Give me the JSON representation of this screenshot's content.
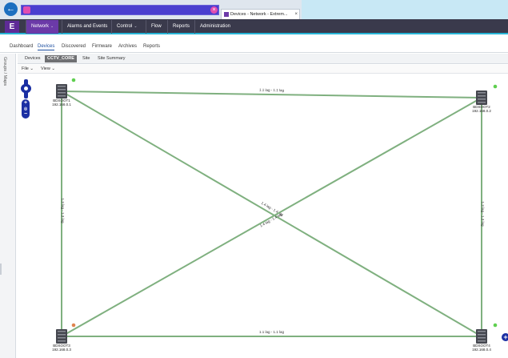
{
  "browser": {
    "tab_title": "Devices - Network - Extrem...",
    "tab_close": "×"
  },
  "appbar": {
    "logo": "E",
    "menu": [
      {
        "label": "Network",
        "active": true
      },
      {
        "label": "Alarms and Events",
        "active": false
      },
      {
        "label": "Control",
        "active": false
      },
      {
        "label": "Flow",
        "active": false
      },
      {
        "label": "Reports",
        "active": false
      },
      {
        "label": "Administration",
        "active": false
      }
    ],
    "caret": "⌄"
  },
  "subnav": [
    "Dashboard",
    "Devices",
    "Discovered",
    "Firmware",
    "Archives",
    "Reports"
  ],
  "subtabs": [
    "Devices",
    "CCTV_CORE",
    "Site",
    "Site Summary"
  ],
  "toolbar": {
    "file": "File",
    "view": "View",
    "caret": "⌄"
  },
  "rail": {
    "label": "Groups / Maps"
  },
  "zoom": {
    "in": "+",
    "mid": "◎",
    "out": "−"
  },
  "topology": {
    "nodes": [
      {
        "name": "BDSOOT1",
        "ip": "192.168.0.1",
        "status": "up"
      },
      {
        "name": "BDSOOT2",
        "ip": "192.168.0.2",
        "status": "up"
      },
      {
        "name": "BDSOOT3",
        "ip": "192.168.0.3",
        "status": "warning"
      },
      {
        "name": "BDSOOT4",
        "ip": "192.168.0.4",
        "status": "up"
      }
    ],
    "links": [
      {
        "from": 0,
        "to": 1,
        "label": "1.1 lag - 1.1 lag"
      },
      {
        "from": 0,
        "to": 2,
        "label": "1.3 lag - 1.3 lag"
      },
      {
        "from": 1,
        "to": 3,
        "label": "1.3 lag - 1.3 lag"
      },
      {
        "from": 2,
        "to": 3,
        "label": "1.1 lag - 1.1 lag"
      },
      {
        "from": 0,
        "to": 3,
        "label": "1.4 lag - 1.4 lag"
      },
      {
        "from": 1,
        "to": 2,
        "label": "1.4 lag - 1.4 lag"
      }
    ],
    "colors": {
      "link": "#7fb07f",
      "up": "#5fcf4f",
      "warning": "#e0844f",
      "device": "#45474f"
    }
  },
  "expand_icon": "+"
}
